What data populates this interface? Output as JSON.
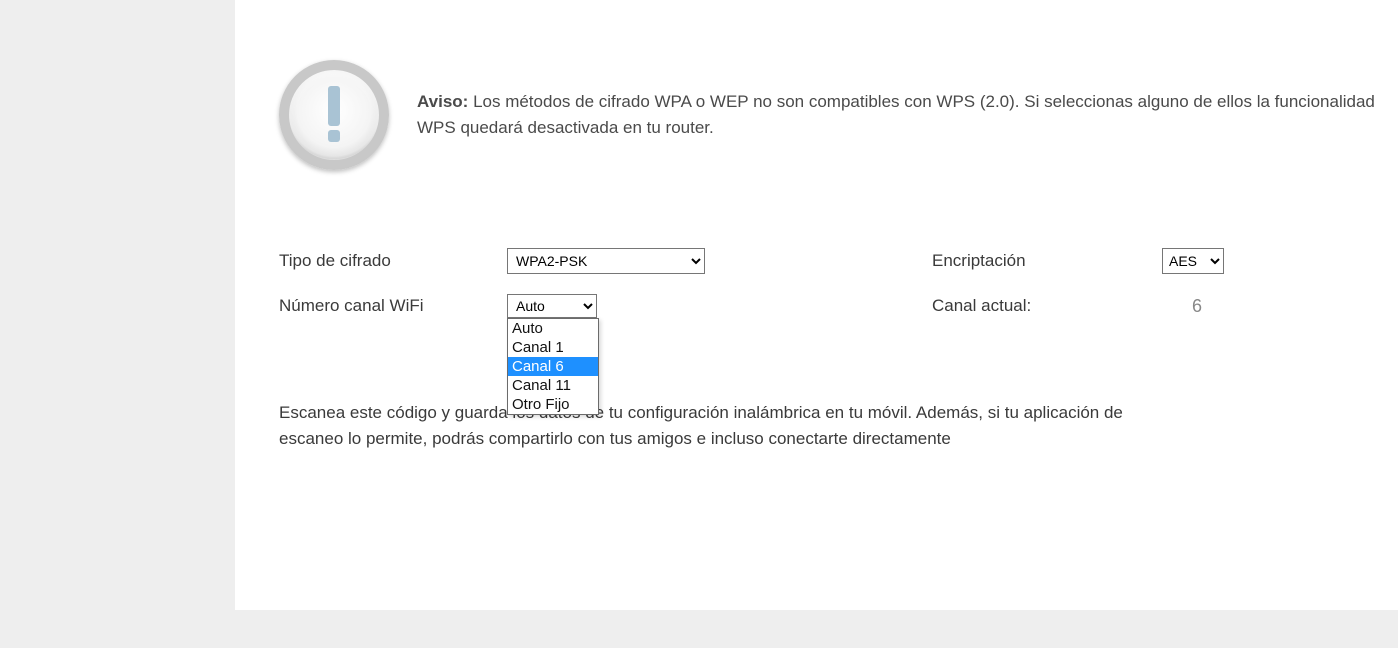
{
  "notice": {
    "prefix": "Aviso:",
    "body": "Los métodos de cifrado WPA o WEP no son compatibles con WPS (2.0). Si seleccionas alguno de ellos la funcionalidad WPS quedará desactivada en tu router."
  },
  "form": {
    "cipher_label": "Tipo de cifrado",
    "cipher_value": "WPA2-PSK",
    "enc_label": "Encriptación",
    "enc_value": "AES",
    "channel_label": "Número canal WiFi",
    "channel_value": "Auto",
    "channel_options": {
      "o0": "Auto",
      "o1": "Canal 1",
      "o2": "Canal 6",
      "o3": "Canal 11",
      "o4": "Otro Fijo"
    },
    "current_channel_label": "Canal actual:",
    "current_channel_value": "6"
  },
  "qr_text": "Escanea este código y guarda los datos de tu configuración inalámbrica en tu móvil. Además, si tu aplicación de escaneo lo permite, podrás compartirlo con tus amigos e incluso conectarte directamente"
}
